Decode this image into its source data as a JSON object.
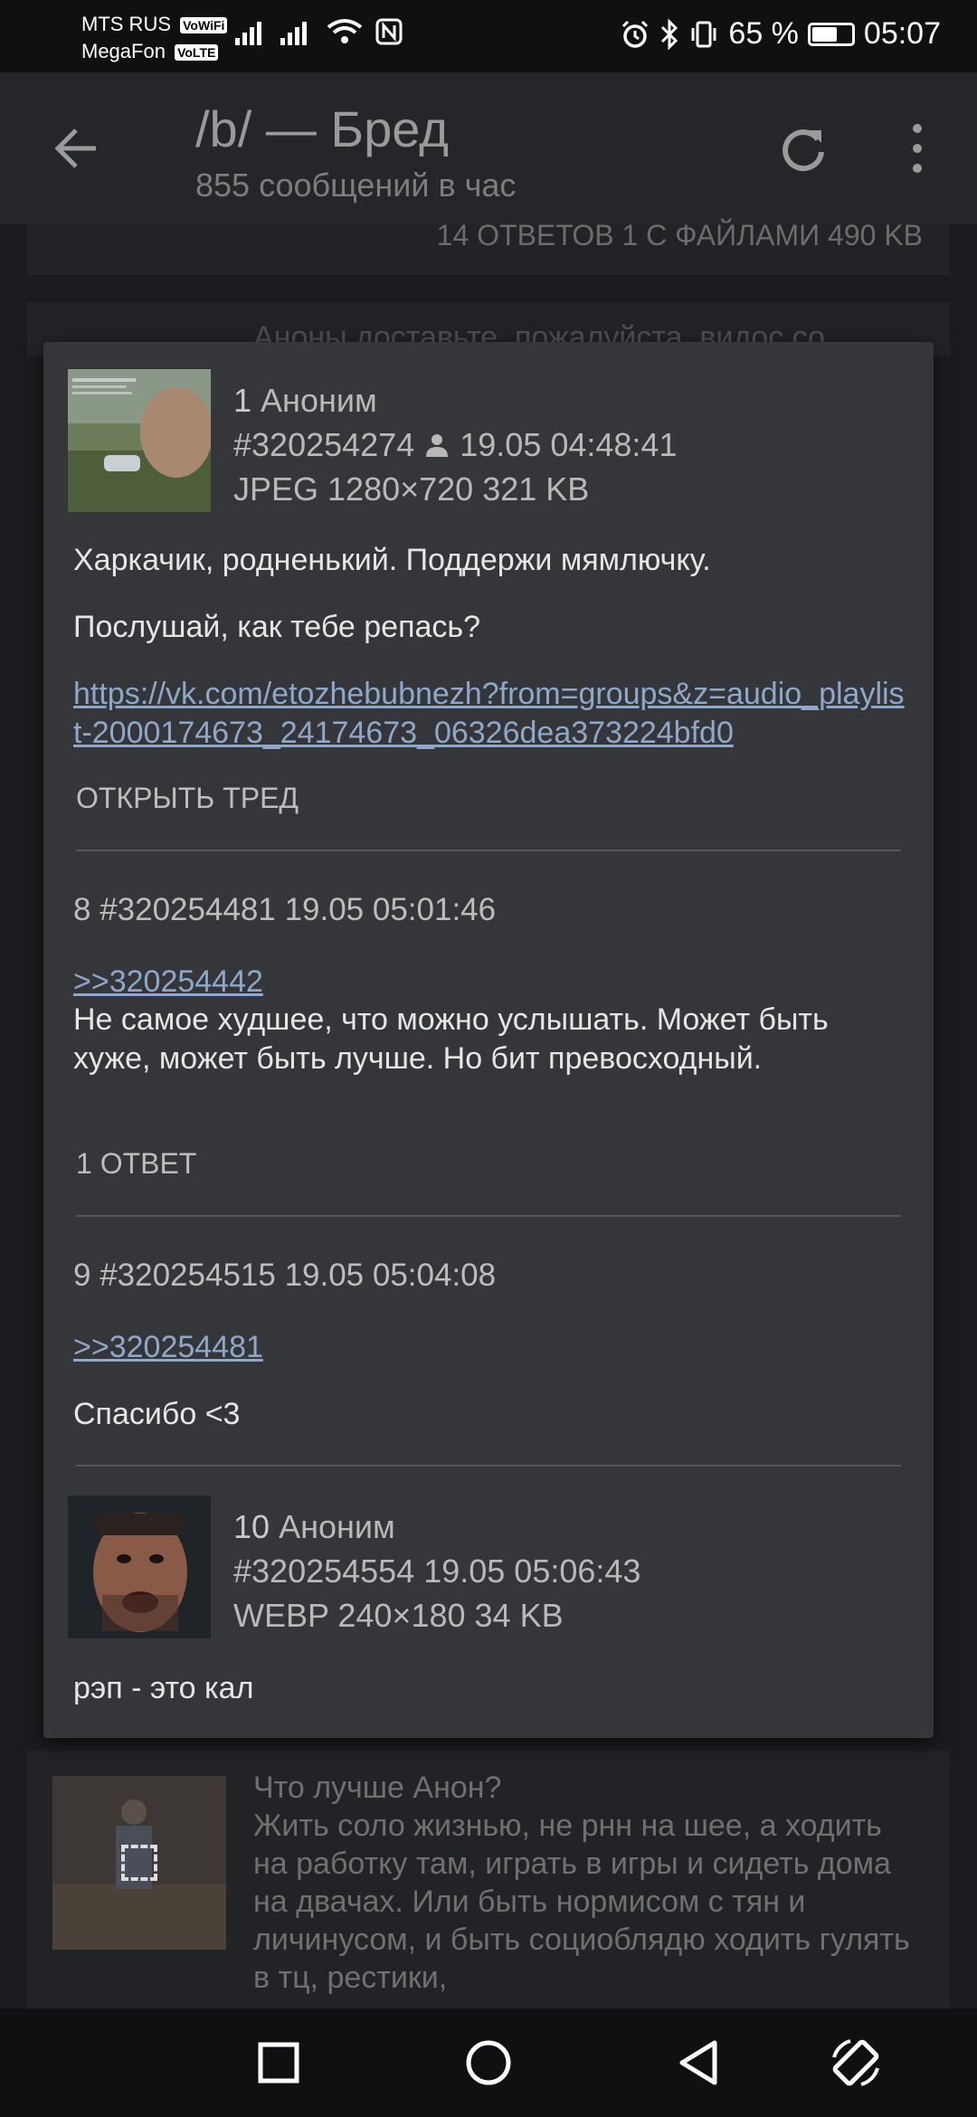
{
  "status_bar": {
    "carrier1": "MTS RUS",
    "carrier1_badge": "VoWiFi",
    "carrier2": "MegaFon",
    "carrier2_badge": "VoLTE",
    "battery_percent": "65 %",
    "battery_level": 0.65,
    "time": "05:07",
    "icons": [
      "signal-icon",
      "signal-icon",
      "wifi-icon",
      "nfc-icon",
      "alarm-icon",
      "bluetooth-icon",
      "vibrate-icon",
      "battery-icon"
    ]
  },
  "app_bar": {
    "title": "/b/ — Бред",
    "subtitle": "855 сообщений в час",
    "icons": [
      "back-icon",
      "refresh-icon",
      "more-vert-icon"
    ]
  },
  "background": {
    "stats": "14 ответов   1 с файлами   490 KB",
    "thread_preview_top": "Аноны доставьте, пожалуйста, видос со",
    "thread_preview": {
      "title": "Что лучше Анон?",
      "text": "Жить соло жизнью, не рнн на шее, а ходить на работку там, играть в игры и сидеть дома на двачах. Или быть нормисом с тян и личинусом, и быть социоблядю ходить гулять в тц, рестики,"
    }
  },
  "popup": {
    "op": {
      "number": "1",
      "author": "Аноним",
      "post_id": "#320254274",
      "date": "19.05 04:48:41",
      "file_info": "JPEG 1280×720 321 KB",
      "text1": "Харкачик, родненький. Поддержи мямлючку.",
      "text2": "Послушай, как тебе репась?",
      "link": "https://vk.com/etozhebubnezh?from=groups&z=audio_playlist-2000174673_24174673_06326dea373224bfd0",
      "action": "Открыть тред"
    },
    "reply8": {
      "header": "8 #320254481 19.05 05:01:46",
      "quote": ">>320254442",
      "text": "Не самое худшее, что можно услышать. Может быть хуже, может быть лучше. Но бит превосходный.",
      "action": "1 ответ"
    },
    "reply9": {
      "header": "9 #320254515 19.05 05:04:08",
      "quote": ">>320254481",
      "text": "Спасибо <3"
    },
    "reply10": {
      "number": "10",
      "author": "Аноним",
      "post_id_date": "#320254554 19.05 05:06:43",
      "file_info": "WEBP 240×180 34 KB",
      "text": "рэп - это кал"
    }
  },
  "nav_bar": {
    "icons": [
      "recents-icon",
      "home-icon",
      "back-triangle-icon",
      "rotate-icon"
    ]
  }
}
